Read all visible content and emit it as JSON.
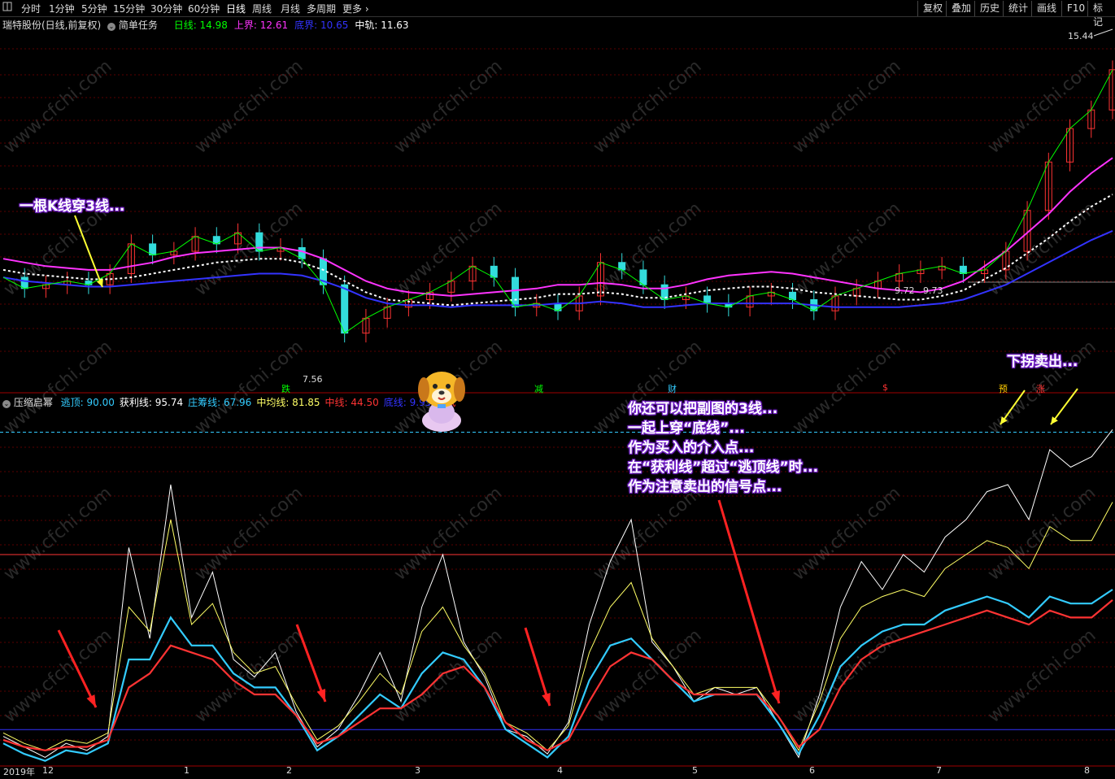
{
  "toolbar": {
    "periods": [
      "分时",
      "1分钟",
      "5分钟",
      "15分钟",
      "30分钟",
      "60分钟",
      "日线",
      "周线",
      "月线",
      "多周期",
      "更多 ›"
    ],
    "active_period": "日线",
    "right_buttons": [
      "复权",
      "叠加",
      "历史",
      "统计",
      "画线",
      "F10",
      "标记"
    ]
  },
  "main_legend": {
    "stock": "瑞特股份(日线,前复权)",
    "task": "简单任务",
    "items": [
      {
        "label": "日线: 14.98",
        "color": "#00ff00"
      },
      {
        "label": "上界: 12.61",
        "color": "#ff33ff"
      },
      {
        "label": "底界: 10.65",
        "color": "#3333ff"
      },
      {
        "label": "中轨: 11.63",
        "color": "#ffffff"
      }
    ]
  },
  "sub_legend": {
    "name": "压缩启幂",
    "items": [
      {
        "label": "逃顶: 90.00",
        "color": "#33ccff"
      },
      {
        "label": "获利线: 95.74",
        "color": "#ffffff"
      },
      {
        "label": "庄筹线: 67.96",
        "color": "#33ccff"
      },
      {
        "label": "中均线: 81.85",
        "color": "#ffff66"
      },
      {
        "label": "中线: 44.50",
        "color": "#ff3333"
      },
      {
        "label": "底线: 9.95",
        "color": "#3333ff"
      },
      {
        "label": "测试",
        "color": "#ff3333"
      }
    ]
  },
  "price_labels": {
    "high": "15.44",
    "low": "7.56",
    "mid1": "9.72",
    "mid2": "9.73"
  },
  "signals": [
    {
      "text": "跌",
      "color": "#00ff00"
    },
    {
      "text": "减",
      "color": "#00ff00"
    },
    {
      "text": "财",
      "color": "#33ccff"
    },
    {
      "text": "$",
      "color": "#ff3333"
    },
    {
      "text": "预",
      "color": "#ffcc00"
    },
    {
      "text": "涨",
      "color": "#ff3333"
    }
  ],
  "annotations": {
    "left": "一根K线穿3线...",
    "right_top": "下拐卖出...",
    "middle": [
      "你还可以把副图的3线...",
      "一起上穿“底线”...",
      "作为买入的介入点...",
      "在“获利线”超过“逃顶线”时...",
      "作为注意卖出的信号点..."
    ]
  },
  "watermark": "www.cfchi.com",
  "x_axis": [
    "2019年",
    "12",
    "1",
    "2",
    "3",
    "4",
    "5",
    "6",
    "7",
    "8"
  ],
  "chart_data": {
    "type": "line",
    "main_panel": {
      "y_range": [
        6.8,
        16.2
      ],
      "series": [
        {
          "name": "上界",
          "color": "#ff33ff",
          "values": [
            9.9,
            9.8,
            9.7,
            9.65,
            9.6,
            9.6,
            9.7,
            9.8,
            9.95,
            10.05,
            10.1,
            10.15,
            10.2,
            10.2,
            10.1,
            9.9,
            9.6,
            9.3,
            9.1,
            9.0,
            8.95,
            8.9,
            8.95,
            9.0,
            9.05,
            9.1,
            9.2,
            9.2,
            9.25,
            9.2,
            9.1,
            9.1,
            9.2,
            9.35,
            9.45,
            9.5,
            9.55,
            9.5,
            9.4,
            9.3,
            9.2,
            9.1,
            9.05,
            9.0,
            9.1,
            9.3,
            9.7,
            10.1,
            10.6,
            11.1,
            11.7,
            12.2,
            12.61
          ]
        },
        {
          "name": "中轨",
          "color": "#ffffff",
          "values": [
            9.6,
            9.5,
            9.45,
            9.4,
            9.35,
            9.35,
            9.4,
            9.5,
            9.6,
            9.7,
            9.8,
            9.85,
            9.9,
            9.9,
            9.8,
            9.6,
            9.3,
            9.0,
            8.8,
            8.75,
            8.7,
            8.65,
            8.7,
            8.75,
            8.8,
            8.85,
            8.95,
            8.95,
            9.0,
            8.95,
            8.85,
            8.85,
            8.95,
            9.05,
            9.1,
            9.15,
            9.15,
            9.1,
            9.0,
            8.95,
            8.9,
            8.85,
            8.8,
            8.8,
            8.9,
            9.05,
            9.35,
            9.65,
            10.05,
            10.45,
            10.9,
            11.3,
            11.63
          ]
        },
        {
          "name": "底界",
          "color": "#3333ff",
          "values": [
            9.4,
            9.3,
            9.25,
            9.2,
            9.15,
            9.15,
            9.2,
            9.25,
            9.3,
            9.35,
            9.4,
            9.45,
            9.5,
            9.5,
            9.45,
            9.3,
            9.1,
            8.85,
            8.7,
            8.65,
            8.65,
            8.6,
            8.65,
            8.65,
            8.65,
            8.65,
            8.7,
            8.7,
            8.75,
            8.7,
            8.6,
            8.6,
            8.65,
            8.7,
            8.7,
            8.7,
            8.7,
            8.7,
            8.65,
            8.6,
            8.6,
            8.6,
            8.6,
            8.65,
            8.7,
            8.8,
            9.0,
            9.2,
            9.5,
            9.8,
            10.1,
            10.4,
            10.65
          ]
        },
        {
          "name": "日线",
          "color": "#00ff00",
          "values": [
            9.4,
            9.1,
            9.2,
            9.3,
            9.2,
            9.5,
            10.3,
            10.0,
            10.1,
            10.5,
            10.3,
            10.6,
            10.1,
            10.2,
            9.9,
            9.2,
            7.9,
            8.3,
            8.6,
            8.8,
            9.0,
            9.3,
            9.7,
            9.4,
            8.6,
            8.7,
            8.5,
            8.9,
            9.8,
            9.6,
            9.2,
            8.8,
            8.9,
            8.7,
            8.6,
            8.9,
            9.0,
            8.8,
            8.5,
            8.9,
            9.1,
            9.3,
            9.5,
            9.6,
            9.7,
            9.5,
            9.6,
            10.1,
            11.2,
            12.5,
            13.4,
            13.9,
            14.98
          ]
        }
      ]
    },
    "sub_panel": {
      "y_range": [
        0,
        100
      ],
      "series": [
        {
          "name": "获利线",
          "color": "#ffffff",
          "values": [
            8,
            5,
            2,
            6,
            4,
            8,
            62,
            36,
            80,
            42,
            55,
            30,
            25,
            32,
            15,
            5,
            10,
            20,
            32,
            18,
            45,
            60,
            35,
            25,
            10,
            8,
            3,
            12,
            40,
            58,
            70,
            35,
            28,
            18,
            22,
            20,
            22,
            12,
            2,
            20,
            45,
            58,
            50,
            60,
            55,
            65,
            70,
            78,
            80,
            70,
            90,
            85,
            88,
            95.74
          ]
        },
        {
          "name": "中均线",
          "color": "#ffff66",
          "values": [
            9,
            6,
            4,
            7,
            6,
            9,
            45,
            38,
            70,
            40,
            46,
            32,
            26,
            28,
            17,
            7,
            11,
            18,
            26,
            20,
            38,
            45,
            34,
            26,
            12,
            9,
            4,
            11,
            32,
            45,
            52,
            36,
            28,
            20,
            22,
            22,
            22,
            14,
            4,
            18,
            36,
            45,
            48,
            50,
            48,
            56,
            60,
            64,
            62,
            56,
            68,
            64,
            64,
            75
          ]
        },
        {
          "name": "庄筹线",
          "color": "#33ccff",
          "values": [
            6,
            3,
            1,
            4,
            3,
            6,
            30,
            30,
            42,
            34,
            34,
            26,
            22,
            22,
            14,
            4,
            8,
            14,
            20,
            16,
            26,
            32,
            30,
            22,
            10,
            6,
            2,
            8,
            24,
            34,
            36,
            30,
            24,
            18,
            20,
            20,
            20,
            12,
            3,
            14,
            28,
            34,
            38,
            40,
            40,
            44,
            46,
            48,
            46,
            42,
            48,
            46,
            46,
            50
          ]
        },
        {
          "name": "中线",
          "color": "#ff3333",
          "values": [
            7,
            5,
            4,
            5,
            5,
            7,
            22,
            26,
            34,
            32,
            30,
            24,
            20,
            20,
            14,
            6,
            8,
            12,
            16,
            16,
            20,
            26,
            28,
            22,
            12,
            7,
            4,
            7,
            18,
            28,
            32,
            30,
            24,
            20,
            20,
            20,
            20,
            14,
            5,
            10,
            22,
            30,
            34,
            36,
            38,
            40,
            42,
            44,
            42,
            40,
            44,
            42,
            42,
            47
          ]
        }
      ],
      "reference_lines": [
        {
          "value": 95,
          "color": "#33ccff",
          "style": "dash"
        },
        {
          "value": 60,
          "color": "#ff3333"
        },
        {
          "value": 9.95,
          "color": "#3333ff"
        }
      ]
    }
  }
}
